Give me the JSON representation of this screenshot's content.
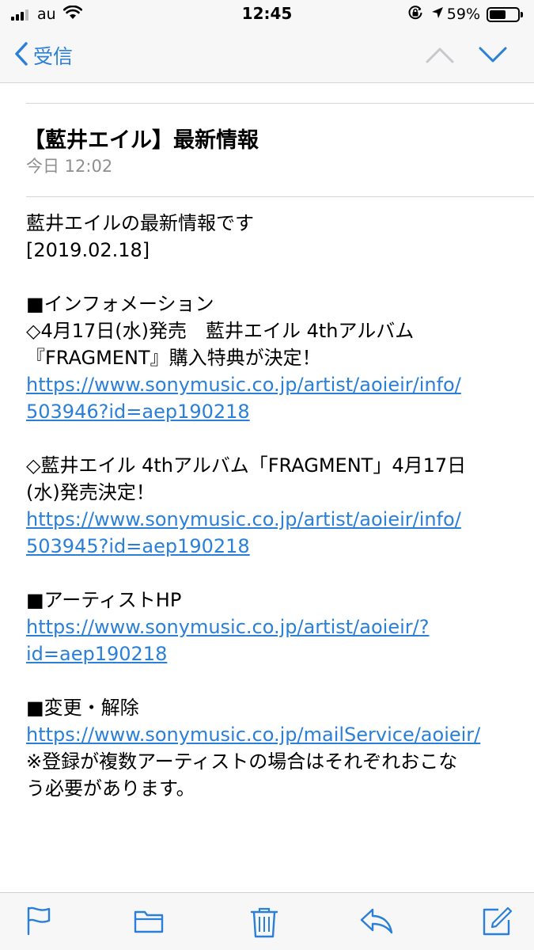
{
  "status_bar": {
    "carrier": "au",
    "time": "12:45",
    "battery_percent": "59%",
    "battery_level": 0.59,
    "icons": [
      "signal-icon",
      "wifi-icon",
      "orientation-lock-icon",
      "location-arrow-icon",
      "battery-icon"
    ]
  },
  "nav": {
    "back_label": "受信",
    "icons": [
      "chevron-left-icon",
      "chevron-up-icon",
      "chevron-down-icon"
    ]
  },
  "mail": {
    "subject": "【藍井エイル】最新情報",
    "date": "今日 12:02",
    "body": {
      "l1": "藍井エイルの最新情報です",
      "l2": "[2019.02.18]",
      "l3": "■インフォメーション",
      "l4": "◇4月17日(水)発売　藍井エイル 4thアルバム",
      "l5": "『FRAGMENT』購入特典が決定！",
      "link1_a": "https://www.sonymusic.co.jp/artist/aoieir/info/",
      "link1_b": "503946?id=aep190218",
      "l6": "◇藍井エイル 4thアルバム「FRAGMENT」4月17日",
      "l7": "(水)発売決定！",
      "link2_a": "https://www.sonymusic.co.jp/artist/aoieir/info/",
      "link2_b": "503945?id=aep190218",
      "l8": "■アーティストHP",
      "link3_a": "https://www.sonymusic.co.jp/artist/aoieir/?",
      "link3_b": "id=aep190218",
      "l9": "■変更・解除",
      "link4": "https://www.sonymusic.co.jp/mailService/aoieir/",
      "l10": "※登録が複数アーティストの場合はそれぞれおこな",
      "l11": "う必要があります。"
    }
  },
  "toolbar": {
    "icons": [
      "flag-icon",
      "folder-icon",
      "trash-icon",
      "reply-icon",
      "compose-icon"
    ]
  },
  "colors": {
    "accent": "#2a7fd9",
    "bar_background": "#f7f7f7",
    "secondary_text": "#8e8e93"
  }
}
